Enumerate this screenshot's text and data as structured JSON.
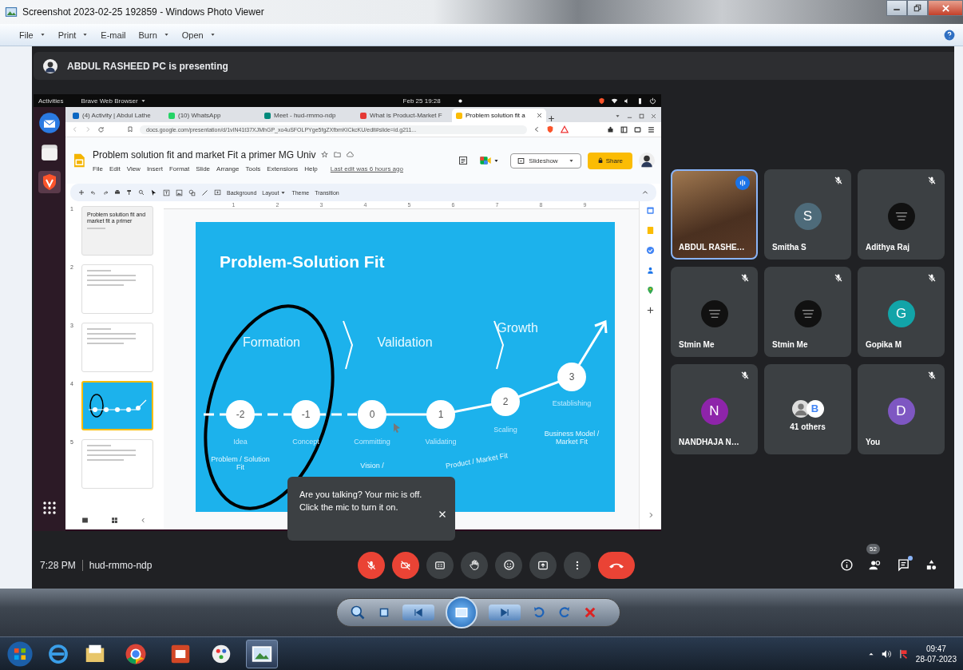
{
  "window": {
    "title": "Screenshot 2023-02-25 192859 - Windows Photo Viewer"
  },
  "menu": [
    {
      "label": "File",
      "dropdown": true
    },
    {
      "label": "Print",
      "dropdown": true
    },
    {
      "label": "E-mail",
      "dropdown": false
    },
    {
      "label": "Burn",
      "dropdown": true
    },
    {
      "label": "Open",
      "dropdown": true
    }
  ],
  "meet": {
    "presenting_banner": "ABDUL RASHEED PC is presenting",
    "shared_screen": {
      "top_bar": {
        "activities": "Activities",
        "app": "Brave Web Browser",
        "clock": "Feb 25  19:28"
      },
      "browser": {
        "tabs": [
          {
            "label": "(4) Activity | Abdul Lathe",
            "selected": false
          },
          {
            "label": "(10) WhatsApp",
            "selected": false
          },
          {
            "label": "Meet - hud-rmmo-ndp",
            "selected": false
          },
          {
            "label": "What is Product-Market F",
            "selected": false
          },
          {
            "label": "Problem solution fit a",
            "selected": true
          }
        ],
        "url": "docs.google.com/presentation/d/1vIN41t37XJMhGP_xo4uSFOLPYge5fgZXfbmKICkcKU/edit#slide=id.g211...",
        "doc_title": "Problem solution fit and market Fit a primer MG Univ",
        "doc_menu": [
          "File",
          "Edit",
          "View",
          "Insert",
          "Format",
          "Slide",
          "Arrange",
          "Tools",
          "Extensions",
          "Help"
        ],
        "last_edit": "Last edit was 6 hours ago",
        "slideshow_button": "Slideshow",
        "share_button": "Share",
        "toolbar_buttons": [
          {
            "label": "Background",
            "dropdown": false
          },
          {
            "label": "Layout",
            "dropdown": true
          },
          {
            "label": "Theme",
            "dropdown": false
          },
          {
            "label": "Transition",
            "dropdown": false
          }
        ],
        "ruler": [
          "1",
          "2",
          "3",
          "4",
          "5",
          "6",
          "7",
          "8",
          "9"
        ],
        "slides": [
          {
            "number": "1",
            "kind": "title",
            "title": "Problem solution fit and market fit a primer",
            "selected": false
          },
          {
            "number": "2",
            "kind": "text",
            "selected": false
          },
          {
            "number": "3",
            "kind": "text",
            "selected": false
          },
          {
            "number": "4",
            "kind": "diagram",
            "selected": true
          },
          {
            "number": "5",
            "kind": "text",
            "selected": false
          }
        ],
        "slide": {
          "title": "Problem-Solution Fit",
          "phases": [
            "Formation",
            "Validation",
            "Growth"
          ],
          "stages": [
            {
              "value": "-2",
              "label": "Idea"
            },
            {
              "value": "-1",
              "label": "Concept"
            },
            {
              "value": "0",
              "label": "Committing"
            },
            {
              "value": "1",
              "label": "Validating"
            },
            {
              "value": "2",
              "label": "Scaling"
            },
            {
              "value": "3",
              "label": "Establishing"
            }
          ],
          "milestones": [
            "Problem / Solution Fit",
            "Vision /",
            "Product / Market Fit",
            "Business Model / Market Fit"
          ]
        }
      }
    },
    "participants": [
      {
        "name": "ABDUL RASHE…",
        "kind": "video",
        "speaking": true,
        "muted": false
      },
      {
        "name": "Smitha S",
        "kind": "letter",
        "initial": "S",
        "color": "#4e6b7a",
        "speaking": false,
        "muted": true
      },
      {
        "name": "Adithya Raj",
        "kind": "photo",
        "speaking": false,
        "muted": true
      },
      {
        "name": "Stmin Me",
        "kind": "photo",
        "speaking": false,
        "muted": true
      },
      {
        "name": "Stmin Me",
        "kind": "photo",
        "speaking": false,
        "muted": true
      },
      {
        "name": "Gopika M",
        "kind": "letter",
        "initial": "G",
        "color": "#12a4a8",
        "speaking": false,
        "muted": true
      },
      {
        "name": "NANDHAJA N…",
        "kind": "letter",
        "initial": "N",
        "color": "#8e24aa",
        "speaking": false,
        "muted": true
      },
      {
        "name": "41 others",
        "kind": "others",
        "initial": "B",
        "speaking": false,
        "muted": false
      },
      {
        "name": "You",
        "kind": "letter",
        "initial": "D",
        "color": "#7e57c2",
        "speaking": false,
        "muted": true
      }
    ],
    "toast": {
      "message": "Are you talking? Your mic is off. Click the mic to turn it on."
    },
    "meeting_time": "7:28 PM",
    "meeting_code": "hud-rmmo-ndp",
    "controls": [
      {
        "kind": "mic",
        "on": false
      },
      {
        "kind": "camera",
        "on": false
      },
      {
        "kind": "captions"
      },
      {
        "kind": "hand"
      },
      {
        "kind": "emoji"
      },
      {
        "kind": "present"
      },
      {
        "kind": "more"
      },
      {
        "kind": "end-call"
      }
    ],
    "side_buttons": [
      {
        "kind": "info"
      },
      {
        "kind": "people",
        "badge": "52"
      },
      {
        "kind": "chat",
        "unread": true
      },
      {
        "kind": "activities"
      }
    ]
  },
  "taskbar": {
    "time": "09:47",
    "date": "28-07-2023"
  }
}
